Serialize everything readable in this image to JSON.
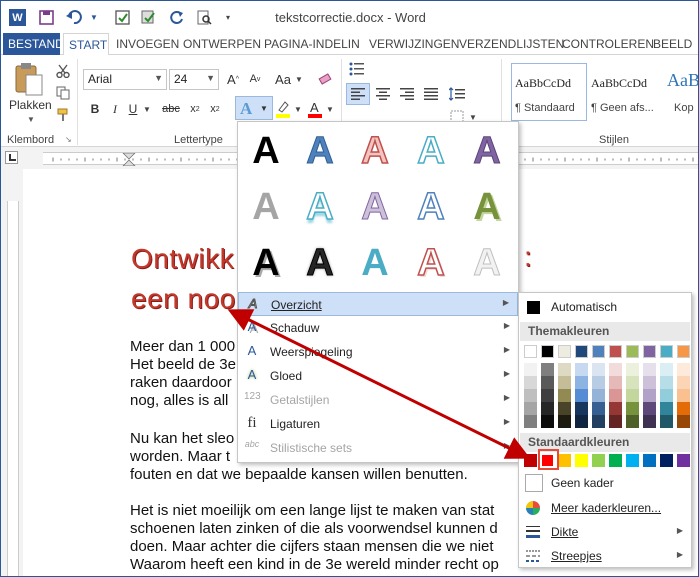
{
  "window": {
    "title": "tekstcorrectie.docx - Word"
  },
  "tabs": [
    "BESTAND",
    "START",
    "INVOEGEN",
    "ONTWERPEN",
    "PAGINA-INDELIN",
    "VERWIJZINGEN",
    "VERZENDLIJSTEN",
    "CONTROLEREN",
    "BEELD"
  ],
  "ribbon": {
    "clipboard_group": "Klembord",
    "paste_label": "Plakken",
    "font_group": "Lettertype",
    "font_name": "Arial",
    "font_size": "24",
    "styles_group": "Stijlen",
    "styles": [
      {
        "preview": "AaBbCcDd",
        "name": "¶ Standaard"
      },
      {
        "preview": "AaBbCcDd",
        "name": "¶ Geen afs..."
      },
      {
        "preview": "AaBb",
        "name": "Kop"
      }
    ]
  },
  "document": {
    "heading_line1": "Ontwikk",
    "heading_colon": ":",
    "heading_line2": "een noo",
    "para1": [
      "Meer dan 1 000",
      "Het beeld de 3e",
      "raken daardoor",
      "nog, alles is all"
    ],
    "para2": [
      "Nu kan het sleo",
      "worden. Maar t",
      "fouten en dat we bepaalde kansen willen benutten."
    ],
    "para3": [
      "Het is niet moeilijk om een lange lijst te maken van stat",
      "schoenen laten zinken of die als voorwendsel kunnen d",
      "doen. Maar achter die cijfers staan mensen die we niet",
      "Waarom heeft een kind in de 3e wereld minder recht op"
    ]
  },
  "effects_menu": {
    "items": [
      {
        "label": "Overzicht",
        "icon": "outline-a-icon",
        "enabled": true,
        "submenu": true
      },
      {
        "label": "Schaduw",
        "icon": "shadow-a-icon",
        "enabled": true,
        "submenu": true
      },
      {
        "label": "Weerspiegeling",
        "icon": "reflection-a-icon",
        "enabled": true,
        "submenu": true
      },
      {
        "label": "Gloed",
        "icon": "glow-a-icon",
        "enabled": true,
        "submenu": true
      },
      {
        "label": "Getalstijlen",
        "icon": "number-styles-icon",
        "icon_text": "123",
        "enabled": false,
        "submenu": true
      },
      {
        "label": "Ligaturen",
        "icon": "ligature-icon",
        "icon_text": "fi",
        "enabled": true,
        "submenu": true
      },
      {
        "label": "Stilistische sets",
        "icon": "stylistic-sets-icon",
        "icon_text": "abc",
        "enabled": false,
        "submenu": true
      }
    ]
  },
  "outline_menu": {
    "automatic": "Automatisch",
    "theme_colors_header": "Themakleuren",
    "standard_colors_header": "Standaardkleuren",
    "no_outline": "Geen kader",
    "more_colors": "Meer kaderkleuren...",
    "weight": "Dikte",
    "dashes": "Streepjes",
    "theme_top": [
      "#ffffff",
      "#000000",
      "#e7e6e6",
      "#44546a",
      "#5b9bd5",
      "#ed7d31",
      "#a5a5a5",
      "#ffc000",
      "#4472c4",
      "#70ad47",
      "#264478"
    ],
    "theme_top_visible": [
      "#ffffff",
      "#000000",
      "#eeece1",
      "#1f497d",
      "#4f81bd",
      "#c0504d",
      "#9bbb59",
      "#8064a2",
      "#4bacc6",
      "#f79646"
    ],
    "theme_shades": [
      [
        "#f2f2f2",
        "#7f7f7f",
        "#ddd9c3",
        "#c6d9f0",
        "#dbe5f1",
        "#f2dcdb",
        "#ebf1dd",
        "#e5e0ec",
        "#dbeef3",
        "#fdeada"
      ],
      [
        "#d8d8d8",
        "#595959",
        "#c4bd97",
        "#8db3e2",
        "#b8cce4",
        "#e5b9b7",
        "#d7e3bc",
        "#ccc1d9",
        "#b7dde8",
        "#fbd5b5"
      ],
      [
        "#bfbfbf",
        "#3f3f3f",
        "#938953",
        "#548dd4",
        "#95b3d7",
        "#d99694",
        "#c3d69b",
        "#b2a2c7",
        "#92cddc",
        "#fac08f"
      ],
      [
        "#a5a5a5",
        "#262626",
        "#494429",
        "#17365d",
        "#366092",
        "#953734",
        "#76923c",
        "#5f497a",
        "#31859b",
        "#e36c09"
      ],
      [
        "#7f7f7f",
        "#0c0c0c",
        "#1d1b10",
        "#0f243e",
        "#244061",
        "#632423",
        "#4f6128",
        "#3f3151",
        "#205867",
        "#974806"
      ]
    ],
    "standard": [
      "#c00000",
      "#ff0000",
      "#ffc000",
      "#ffff00",
      "#92d050",
      "#00b050",
      "#00b0f0",
      "#0070c0",
      "#002060",
      "#7030a0"
    ]
  },
  "colors": {
    "accent": "#2b579a",
    "annotation": "#c00000"
  }
}
